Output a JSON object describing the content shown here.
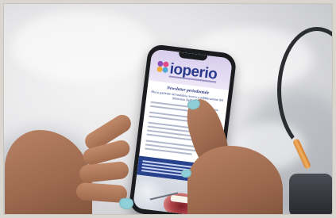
{
  "app": {
    "logo_text": "ioperio",
    "newsletter_title": "Newsletter periodontale",
    "newsletter_subtitle": "Ma la paziente nel malattia ricerca a pubblicazione del Ministero Dell'ipotesi"
  },
  "icons": {
    "logo": "flower-logo-icon"
  },
  "colors": {
    "logo_blue": "#2a3a8c",
    "header_lavender": "#d7cdec",
    "band_blue": "#28418c",
    "nail_teal": "#8fd0d8"
  }
}
